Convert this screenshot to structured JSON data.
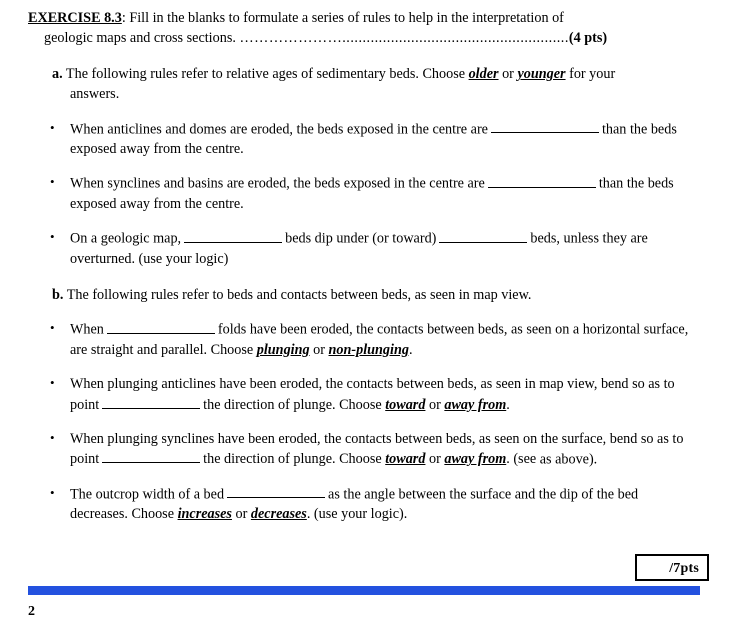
{
  "document": {
    "heading": {
      "exercise_label": "EXERCISE 8.3",
      "colon": ":",
      "line1_text": " Fill in the blanks to formulate a series of rules to help in the interpretation of",
      "line2_text": "geologic maps and cross sections. ",
      "leader_dots": "…………………........................................................",
      "points": "(4 pts)"
    },
    "part_a": {
      "marker": "a.",
      "text_before_choice1": " The following rules refer to relative ages of sedimentary beds. Choose ",
      "choice1": "older",
      "between_choices": " or ",
      "choice2": "younger",
      "text_after_choice2": " for your",
      "continuation": "answers."
    },
    "part_a_bullets": [
      {
        "bullet_glyph": "•",
        "segment1": "When anticlines and domes are eroded, the beds exposed in the centre are",
        "blank1_width": "long",
        "segment2": "than",
        "line2": "the beds exposed away from the centre."
      },
      {
        "bullet_glyph": "•",
        "segment1": "When synclines and basins are eroded, the beds exposed in the centre are",
        "blank1_width": "long",
        "segment2": "than",
        "line2": "the beds exposed away from the centre."
      },
      {
        "bullet_glyph": "•",
        "segment1": "On a geologic map,",
        "blank1_width": "med",
        "segment2": "beds dip under (or toward)",
        "blank2_width": "short",
        "segment3": "beds, unless",
        "line2": "they are overturned. (use your logic)"
      }
    ],
    "part_b": {
      "marker": "b.",
      "text": " The following rules refer to beds and contacts between beds, as seen in map view."
    },
    "part_b_bullets": [
      {
        "bullet_glyph": "•",
        "segment1": "When",
        "blank1_width": "long",
        "segment2": "folds have been eroded, the contacts between beds, as seen on a",
        "line2_before": "horizontal surface, are straight and parallel. Choose ",
        "choice1": "plunging",
        "between": " or ",
        "choice2": "non-plunging",
        "line2_after": "."
      },
      {
        "bullet_glyph": "•",
        "segment1": "When plunging anticlines have been eroded, the contacts between beds, as seen in map view,",
        "line2_before_blank": "bend so as to point",
        "blank1_width": "med",
        "line2_mid": "the direction of plunge. Choose ",
        "choice1": "toward",
        "between": " or ",
        "choice2": "away from",
        "line2_after": "."
      },
      {
        "bullet_glyph": "•",
        "segment1": "When plunging synclines have been eroded, the contacts between beds, as seen on the surface,",
        "line2_before_blank": "bend so as to point",
        "blank1_width": "med",
        "line2_mid": "the direction of plunge. Choose ",
        "choice1": "toward",
        "between": " or ",
        "choice2": "away from",
        "line2_after": ". (see",
        "line3": "as above)."
      },
      {
        "bullet_glyph": "•",
        "segment1": "The outcrop width of a bed",
        "blank1_width": "med",
        "segment2": "as the angle between the surface and the dip of the",
        "line2_before": "bed decreases. Choose ",
        "choice1": "increases",
        "between": " or ",
        "choice2": "decreases",
        "line2_after": ". (use your logic)."
      }
    ],
    "footer": {
      "score_text": "/7pts",
      "page_number": "2",
      "rule_color": "#2351df"
    }
  }
}
